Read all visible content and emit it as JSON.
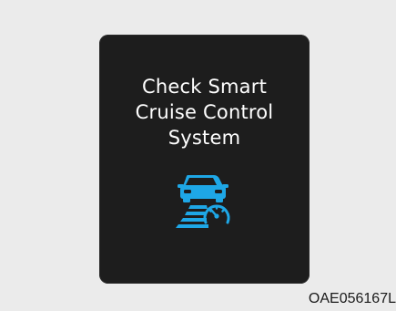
{
  "display": {
    "message_lines": [
      "Check Smart",
      "Cruise Control",
      "System"
    ],
    "icon": "smart-cruise-control-warning-icon",
    "icon_color": "#1ea7e6",
    "text_color": "#ffffff",
    "panel_color": "#1d1d1d",
    "background_color": "#ebebeb"
  },
  "image_code": "OAE056167L"
}
